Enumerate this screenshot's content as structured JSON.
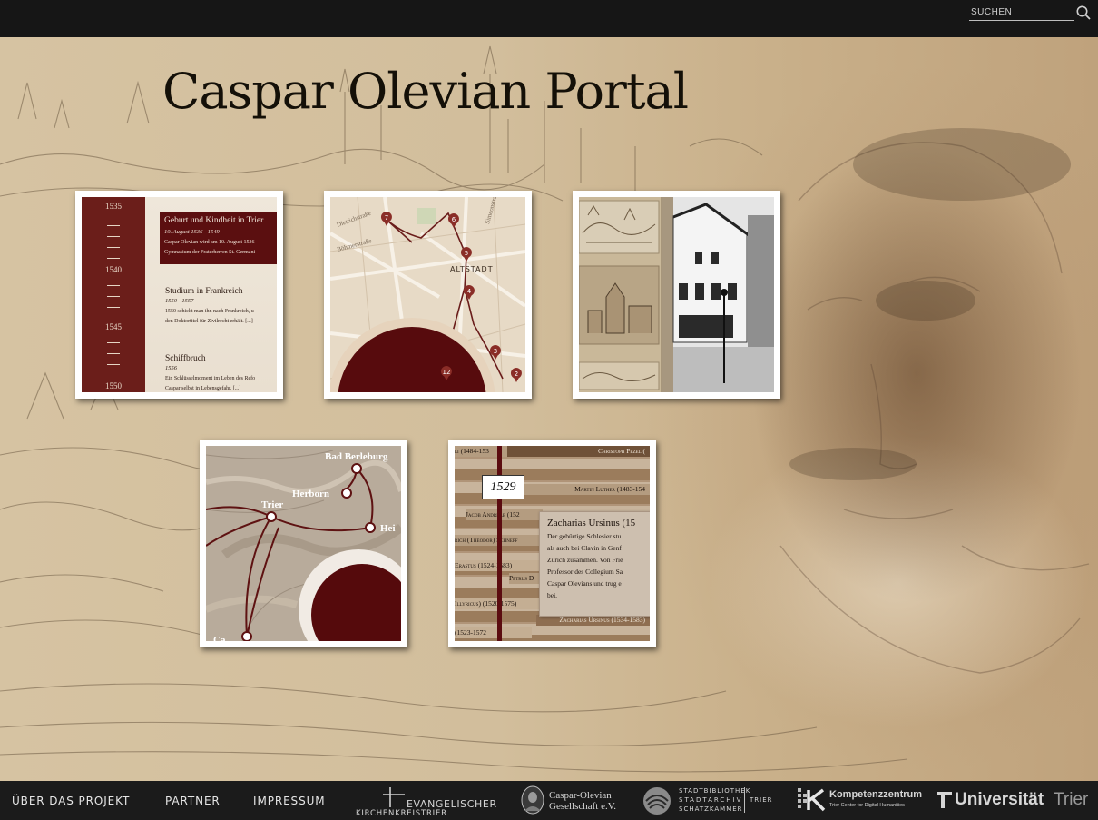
{
  "search": {
    "placeholder": "SUCHEN",
    "icon": "search-icon"
  },
  "page": {
    "title": "Caspar Olevian Portal"
  },
  "tiles": {
    "timeline": {
      "years": [
        "1535",
        "1540",
        "1545",
        "1550"
      ],
      "highlight": {
        "heading": "Geburt und Kindheit in Trier",
        "date": "10. August 1536 - 1549",
        "text1": "Caspar Olevian wird am 10. August 1536",
        "text2": "Gymnasium der Fraterherren St. Germani"
      },
      "events": [
        {
          "heading": "Studium in Frankreich",
          "date": "1550 - 1557",
          "text1": "1550 schickt man ihn nach Frankreich, u",
          "text2": "den Doktortitel für Zivilrecht erhält. [...]"
        },
        {
          "heading": "Schiffbruch",
          "date": "1556",
          "text1": "Ein Schlüsselmoment im Leben des Refo",
          "text2": "Caspar selbst in Lebensgefahr. [...]"
        }
      ]
    },
    "stadtplan": {
      "streets": [
        "Dietrichstraße",
        "Böhmerstraße",
        "Simeonstraße"
      ],
      "district": "ALTSTADT",
      "markers": [
        "7",
        "6",
        "5",
        "4",
        "3",
        "2",
        "12"
      ]
    },
    "orte": {
      "places": [
        "Bad Berleburg",
        "Herborn",
        "Trier",
        "Hei",
        "Ca"
      ]
    },
    "zeitleiste": {
      "year": "1529",
      "rows": [
        {
          "label": "li (1484-153",
          "align": "left"
        },
        {
          "label": "Christoph Pezel (",
          "align": "right"
        },
        {
          "label": "Martin Luther (1483-154",
          "align": "right"
        },
        {
          "label": "Jacob Andreae (152",
          "align": "left"
        },
        {
          "label": "rich (Theodor) Schnepf",
          "align": "left"
        },
        {
          "label": "Erastus (1524-1583)",
          "align": "left"
        },
        {
          "label": "Petrus D",
          "align": "left"
        },
        {
          "label": "Illyricus) (1520-1575)",
          "align": "left"
        },
        {
          "label": "Zacharias Ursinus (1534-1583)",
          "align": "right"
        },
        {
          "label": "(1523-1572",
          "align": "left"
        }
      ],
      "popup": {
        "heading": "Zacharias Ursinus (15",
        "lines": [
          "Der gebürtige Schlesier stu",
          "als auch bei Clavin in Genf",
          "Zürich zusammen. Von Frie",
          "Professor des Collegium Sa",
          "Caspar Olevians und trug e",
          "bei."
        ]
      }
    }
  },
  "footer": {
    "nav": [
      "ÜBER DAS PROJEKT",
      "PARTNER",
      "IMPRESSUM"
    ],
    "logos": {
      "ekk_top": "EVANGELISCHER",
      "ekk_bottom": "KIRCHENKREISTRIER",
      "cog_line1": "Caspar-Olevian",
      "cog_line2": "Gesellschaft e.V.",
      "stb_line1": "STADTBIBLIOTHEK",
      "stb_line2": "STADTARCHIV",
      "stb_line3": "SCHATZKAMMER",
      "stb_city": "TRIER",
      "kz_main": "Kompetenzzentrum",
      "kz_sub": "Trier Center for Digital Humanities",
      "uni_main": "Universität",
      "uni_city": "Trier"
    }
  }
}
